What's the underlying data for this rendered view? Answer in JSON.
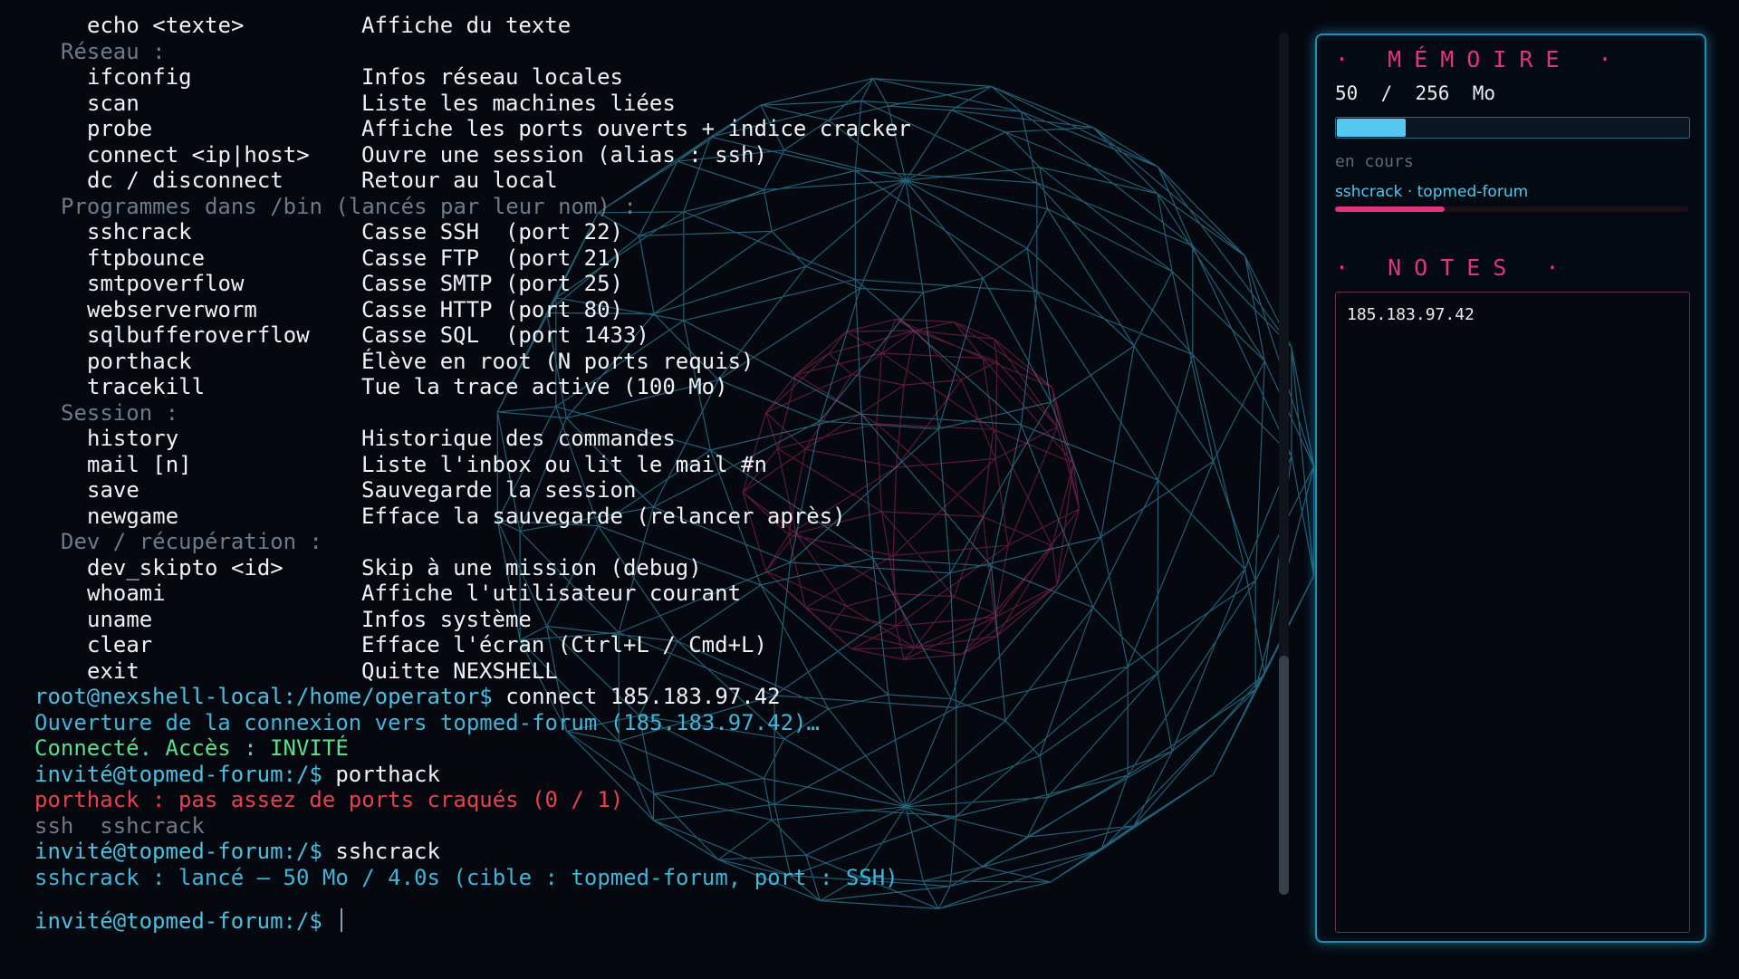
{
  "terminal": {
    "help_partial": {
      "cmd": "echo <texte>",
      "desc": "Affiche du texte"
    },
    "help_sections": [
      {
        "category": "Réseau :",
        "commands": [
          {
            "cmd": "ifconfig",
            "desc": "Infos réseau locales"
          },
          {
            "cmd": "scan",
            "desc": "Liste les machines liées"
          },
          {
            "cmd": "probe",
            "desc": "Affiche les ports ouverts + indice cracker"
          },
          {
            "cmd": "connect <ip|host>",
            "desc": "Ouvre une session (alias : ssh)"
          },
          {
            "cmd": "dc / disconnect",
            "desc": "Retour au local"
          }
        ]
      },
      {
        "category": "Programmes dans /bin (lancés par leur nom) :",
        "commands": [
          {
            "cmd": "sshcrack",
            "desc": "Casse SSH  (port 22)"
          },
          {
            "cmd": "ftpbounce",
            "desc": "Casse FTP  (port 21)"
          },
          {
            "cmd": "smtpoverflow",
            "desc": "Casse SMTP (port 25)"
          },
          {
            "cmd": "webserverworm",
            "desc": "Casse HTTP (port 80)"
          },
          {
            "cmd": "sqlbufferoverflow",
            "desc": "Casse SQL  (port 1433)"
          },
          {
            "cmd": "porthack",
            "desc": "Élève en root (N ports requis)"
          },
          {
            "cmd": "tracekill",
            "desc": "Tue la trace active (100 Mo)"
          }
        ]
      },
      {
        "category": "Session :",
        "commands": [
          {
            "cmd": "history",
            "desc": "Historique des commandes"
          },
          {
            "cmd": "mail [n]",
            "desc": "Liste l'inbox ou lit le mail #n"
          },
          {
            "cmd": "save",
            "desc": "Sauvegarde la session"
          },
          {
            "cmd": "newgame",
            "desc": "Efface la sauvegarde (relancer après)"
          }
        ]
      },
      {
        "category": "Dev / récupération :",
        "commands": [
          {
            "cmd": "dev_skipto <id>",
            "desc": "Skip à une mission (debug)"
          },
          {
            "cmd": "whoami",
            "desc": "Affiche l'utilisateur courant"
          },
          {
            "cmd": "uname",
            "desc": "Infos système"
          },
          {
            "cmd": "clear",
            "desc": "Efface l'écran (Ctrl+L / Cmd+L)"
          },
          {
            "cmd": "exit",
            "desc": "Quitte NEXSHELL"
          }
        ]
      }
    ],
    "log": {
      "prompt_local": "root@nexshell-local:/home/operator$",
      "cmd_connect": "connect 185.183.97.42",
      "opening": "Ouverture de la connexion vers topmed-forum (185.183.97.42)…",
      "connected": "Connecté. Accès : INVITÉ",
      "prompt_remote": "invité@topmed-forum:/$",
      "cmd_porthack": "porthack",
      "porthack_error": "porthack : pas assez de ports craqués (0 / 1)",
      "hint": "ssh  sshcrack",
      "cmd_sshcrack": "sshcrack",
      "sshcrack_launched": "sshcrack : lancé — 50 Mo / 4.0s (cible : topmed-forum, port : SSH)"
    }
  },
  "memory": {
    "title": "· MÉMOIRE ·",
    "used": 50,
    "total": 256,
    "readout": "50  /  256  Mo",
    "running_label": "en cours",
    "process_label": "sshcrack · topmed-forum",
    "process_progress": 0.31
  },
  "notes": {
    "title": "· NOTES ·",
    "content": "185.183.97.42"
  },
  "colors": {
    "prompt": "#4cc0df",
    "success": "#59e08f",
    "error": "#e8404f",
    "accent_pink": "#e0357a",
    "accent_cyan": "#54c8f0"
  }
}
